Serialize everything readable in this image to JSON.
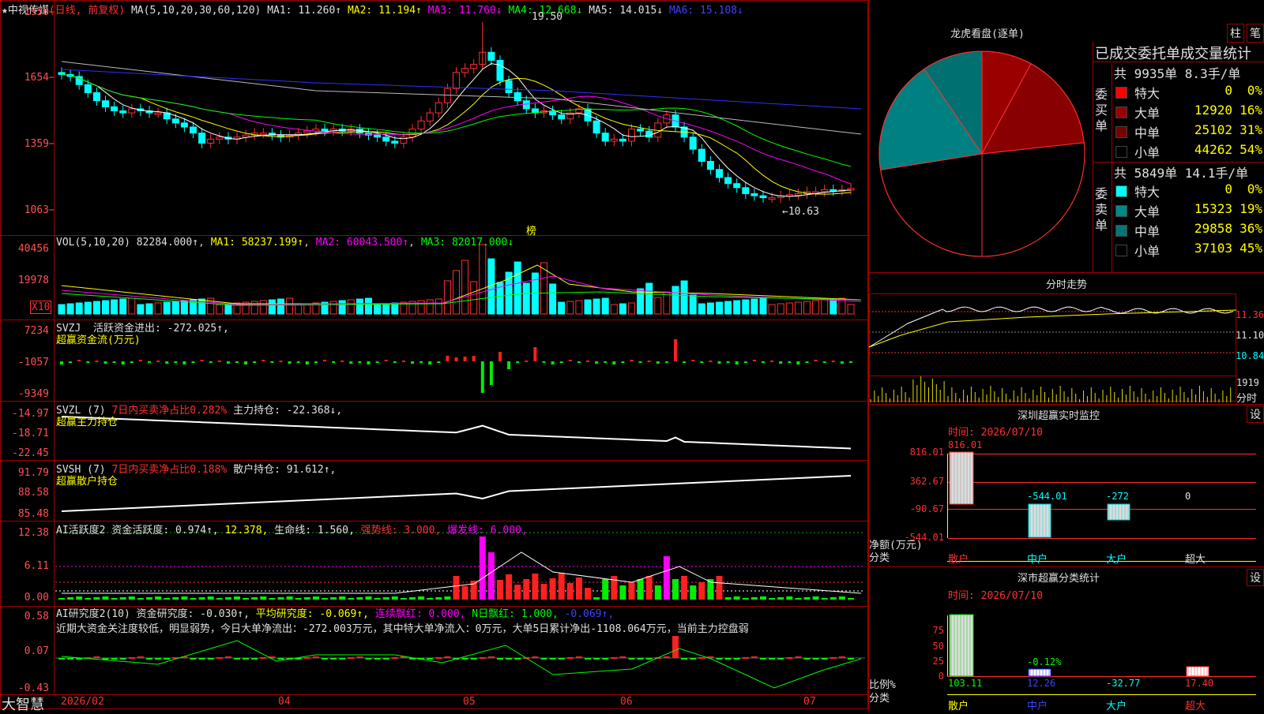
{
  "stock": {
    "name": "中视传媒",
    "mode": "(日线, 前复权)",
    "star": "★"
  },
  "ma_legend": {
    "ma": "MA(5,10,20,30,60,120)",
    "ma1": "MA1: 11.260↑",
    "ma2": "MA2: 11.194↑",
    "ma3": "MA3: 11.760↓",
    "ma4": "MA4: 12.668↓",
    "ma5": "MA5: 14.015↓",
    "ma6": "MA6: 15.108↓"
  },
  "main_axis": [
    "1950",
    "1654",
    "1359",
    "1063"
  ],
  "high_mark": "19.50",
  "low_mark": "←10.63",
  "bang_label": "榜",
  "vol_legend": {
    "name": "VOL(5,10,20)",
    "v": "82284.000↑",
    "ma1": "MA1: 58237.199↑",
    "ma2": "MA2: 60043.500↑",
    "ma3": "MA3: 82017.000↓"
  },
  "vol_axis": [
    "40456",
    "19978"
  ],
  "x10": "X10",
  "svzj": {
    "name": "SVZJ",
    "l1": "活跃资金进出: -272.025↑,",
    "l2": "超赢资金流(万元)",
    "axis": [
      "7234",
      "-1057",
      "-9349"
    ]
  },
  "svzl": {
    "name": "SVZL (7)",
    "l1": "7日内买卖净占比0.282%",
    "l2": "主力持仓: -22.368↓,",
    "l3": "超赢主力持仓",
    "axis": [
      "-14.97",
      "-18.71",
      "-22.45"
    ]
  },
  "svsh": {
    "name": "SVSH (7)",
    "l1": "7日内买卖净占比0.188%",
    "l2": "散户持仓: 91.612↑,",
    "l3": "超赢散户持仓",
    "axis": [
      "91.79",
      "88.58",
      "85.48"
    ]
  },
  "ai1": {
    "name": "AI活跃度2",
    "l1": "资金活跃度: 0.974↑,",
    "l2": "12.378,",
    "l3": "生命线: 1.560,",
    "l4": "强势线: 3.000,",
    "l5": "爆发线: 6.000,",
    "axis": [
      "12.38",
      "6.11",
      "0.00"
    ]
  },
  "ai2": {
    "name": "AI研究度2(10)",
    "l1": "资金研究度: -0.030↑,",
    "l2": "平均研究度: -0.069↑,",
    "l3": "连续飘红: 0.000,",
    "l4": "N日飘红: 1.000,",
    "l5": "-0.069↑,",
    "comment": "近期大资金关注度较低，明显弱势，今日大单净流出：-272.003万元，其中特大单净流入：0万元，大单5日累计净出-1108.064万元，当前主力控盘弱",
    "axis": [
      "0.58",
      "0.07",
      "-0.43"
    ]
  },
  "x_axis": {
    "brand": "大智慧",
    "labels": [
      "2026/02",
      "04",
      "05",
      "06",
      "07"
    ]
  },
  "longhu": {
    "title": "龙虎看盘(逐单)",
    "btn1": "柱",
    "btn2": "笔",
    "header": "已成交委托单成交量统计",
    "buy": {
      "label": "委买单",
      "total": "共 9935单 8.3手/单",
      "rows": [
        {
          "name": "特大",
          "val": "0",
          "pct": "0%",
          "color": "#ff0000"
        },
        {
          "name": "大单",
          "val": "12920",
          "pct": "16%",
          "color": "#990000"
        },
        {
          "name": "中单",
          "val": "25102",
          "pct": "31%",
          "color": "#770000"
        },
        {
          "name": "小单",
          "val": "44262",
          "pct": "54%",
          "color": "#000000"
        }
      ]
    },
    "sell": {
      "label": "委卖单",
      "total": "共 5849单 14.1手/单",
      "rows": [
        {
          "name": "特大",
          "val": "0",
          "pct": "0%",
          "color": "#00ffff"
        },
        {
          "name": "大单",
          "val": "15323",
          "pct": "19%",
          "color": "#008888"
        },
        {
          "name": "中单",
          "val": "29858",
          "pct": "36%",
          "color": "#007777"
        },
        {
          "name": "小单",
          "val": "37103",
          "pct": "45%",
          "color": "#000000"
        }
      ]
    }
  },
  "fenshi": {
    "title": "分时走势",
    "axis": [
      "11.36",
      "11.10",
      "10.84"
    ],
    "vol": "1919",
    "vol_label": "分时"
  },
  "sz_monitor": {
    "title": "深圳超赢实时监控",
    "btn": "设",
    "time": "时间: 2026/07/10",
    "axis": [
      "816.01",
      "362.67",
      "-90.67",
      "-544.01"
    ],
    "unit": "净额(万元)",
    "unit2": "分类",
    "cats": [
      "散户",
      "中户",
      "大户",
      "超大"
    ],
    "values": [
      "816.01",
      "-544.01",
      "-272",
      "0"
    ]
  },
  "sz_class": {
    "title": "深市超赢分类统计",
    "btn": "设",
    "time": "时间: 2026/07/10",
    "axis": [
      "75",
      "50",
      "25",
      "0"
    ],
    "unit": "比例%",
    "unit2": "分类",
    "cats": [
      "散户",
      "中户",
      "大户",
      "超大"
    ],
    "values": [
      "103.11",
      "12.26",
      "-32.77",
      "17.40"
    ],
    "mid": "-0.12%"
  },
  "chart_data": {
    "type": "candlestick",
    "title": "中视传媒 (日线, 前复权)",
    "x_labels": [
      "2026/02",
      "04",
      "05",
      "06",
      "07"
    ],
    "price_range": [
      10.63,
      19.5
    ],
    "ma": {
      "MA1": 11.26,
      "MA2": 11.194,
      "MA3": 11.76,
      "MA4": 12.668,
      "MA5": 14.015,
      "MA6": 15.108
    },
    "close_series": [
      16.9,
      16.8,
      16.4,
      16.0,
      15.6,
      15.3,
      15.1,
      15.0,
      15.2,
      15.1,
      15.0,
      15.0,
      14.7,
      14.5,
      14.3,
      14.0,
      13.5,
      13.7,
      13.8,
      13.7,
      13.8,
      13.9,
      14.0,
      14.0,
      13.9,
      13.8,
      13.9,
      14.0,
      14.1,
      14.2,
      14.1,
      14.2,
      14.1,
      14.2,
      14.0,
      13.9,
      13.8,
      13.6,
      13.5,
      13.8,
      14.2,
      14.6,
      15.0,
      15.5,
      16.2,
      17.0,
      17.2,
      17.4,
      18.0,
      17.6,
      16.6,
      16.0,
      15.6,
      15.2,
      15.0,
      15.1,
      14.9,
      14.7,
      15.0,
      15.2,
      14.6,
      14.0,
      13.6,
      13.7,
      13.6,
      14.2,
      14.1,
      13.8,
      14.5,
      14.9,
      14.3,
      13.8,
      13.2,
      12.6,
      12.2,
      11.8,
      11.5,
      11.3,
      11.0,
      10.9,
      10.8,
      10.8,
      10.9,
      10.95,
      11.0,
      11.1,
      11.1,
      11.2,
      11.15,
      11.2,
      11.26
    ],
    "volume_max": 40456
  }
}
